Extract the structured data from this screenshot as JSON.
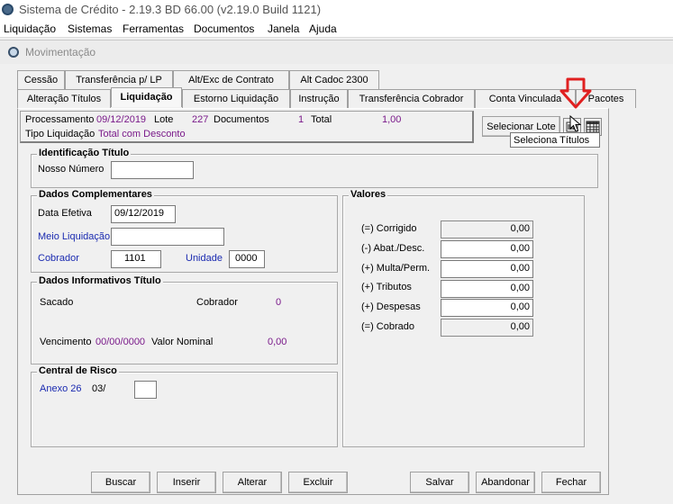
{
  "window": {
    "title": "Sistema de Crédito - 2.19.3 BD 66.00 (v2.19.0 Build 1121)"
  },
  "menu": [
    "Liquidação",
    "Sistemas",
    "Ferramentas",
    "Documentos",
    "Janela",
    "Ajuda"
  ],
  "child": {
    "title": "Movimentação"
  },
  "tabs_row1": [
    "Cessão",
    "Transferência p/ LP",
    "Alt/Exc de Contrato",
    "Alt Cadoc 2300"
  ],
  "tabs_row2": [
    "Alteração Títulos",
    "Liquidação",
    "Estorno Liquidação",
    "Instrução",
    "Transferência Cobrador",
    "Conta Vinculada",
    "Pacotes"
  ],
  "info": {
    "processamento_label": "Processamento",
    "processamento_value": "09/12/2019",
    "lote_label": "Lote",
    "lote_value": "227",
    "documentos_label": "Documentos",
    "documentos_value": "1",
    "total_label": "Total",
    "total_value": "1,00",
    "tipo_label": "Tipo Liquidação",
    "tipo_value": "Total com Desconto"
  },
  "buttons": {
    "selecionar_lote": "Selecionar Lote",
    "selecionar_titulos_icon": "barcode-icon",
    "grid_icon": "grid-icon",
    "tooltip": "Seleciona Títulos"
  },
  "identificacao": {
    "title": "Identificação Título",
    "nosso_numero_label": "Nosso Número",
    "nosso_numero_value": ""
  },
  "complementares": {
    "title": "Dados Complementares",
    "data_efetiva_label": "Data Efetiva",
    "data_efetiva_value": "09/12/2019",
    "meio_label": "Meio Liquidação",
    "meio_value": "",
    "cobrador_label": "Cobrador",
    "cobrador_value": "1101",
    "unidade_label": "Unidade",
    "unidade_value": "0000"
  },
  "informativos": {
    "title": "Dados Informativos Título",
    "sacado_label": "Sacado",
    "cobrador_label": "Cobrador",
    "cobrador_value": "0",
    "vencimento_label": "Vencimento",
    "vencimento_value": "00/00/0000",
    "valor_nominal_label": "Valor Nominal",
    "valor_nominal_value": "0,00"
  },
  "risco": {
    "title": "Central de Risco",
    "anexo_label": "Anexo 26",
    "anexo_value": "03/",
    "anexo_input": ""
  },
  "valores": {
    "title": "Valores",
    "rows": [
      {
        "label": "(=) Corrigido",
        "value": "0,00"
      },
      {
        "label": "(-) Abat./Desc.",
        "value": "0,00"
      },
      {
        "label": "(+) Multa/Perm.",
        "value": "0,00"
      },
      {
        "label": "(+) Tributos",
        "value": "0,00"
      },
      {
        "label": "(+) Despesas",
        "value": "0,00"
      },
      {
        "label": "(=) Cobrado",
        "value": "0,00"
      }
    ]
  },
  "actions": [
    "Buscar",
    "Inserir",
    "Alterar",
    "Excluir",
    "Salvar",
    "Abandonar",
    "Fechar"
  ],
  "colors": {
    "highlight_arrow": "#e02020",
    "value_purple": "#7a1a8a",
    "label_blue": "#1a2ab0"
  }
}
